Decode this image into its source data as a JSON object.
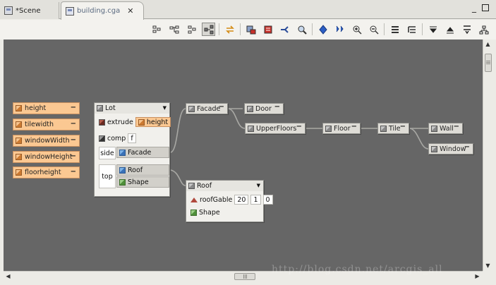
{
  "tabs": [
    {
      "label": "*Scene"
    },
    {
      "label": "building.cga"
    }
  ],
  "attributes": [
    {
      "label": "height"
    },
    {
      "label": "tilewidth"
    },
    {
      "label": "windowWidth"
    },
    {
      "label": "windowHeight"
    },
    {
      "label": "floorheight"
    }
  ],
  "lot": {
    "title": "Lot",
    "extrude_op": "extrude",
    "extrude_arg": "height",
    "comp_op": "comp",
    "comp_arg": "f",
    "side_label": "side",
    "side_target": "Facade",
    "top_label": "top",
    "top_targets": [
      "Roof",
      "Shape"
    ]
  },
  "roof": {
    "title": "Roof",
    "op": "roofGable",
    "args": [
      "20",
      "1",
      "0"
    ],
    "child": "Shape"
  },
  "rules": {
    "facade": "Facade",
    "door": "Door",
    "upperfloors": "UpperFloors",
    "floor": "Floor",
    "tile": "Tile",
    "wall": "Wall",
    "window": "Window"
  },
  "minimize_glyph": "−",
  "watermark": "http://blog.csdn.net/arcgis_all",
  "colors": {
    "canvas": "#666666",
    "attribute_fill": "#fbc892",
    "node_fill": "#f1f0ec"
  }
}
